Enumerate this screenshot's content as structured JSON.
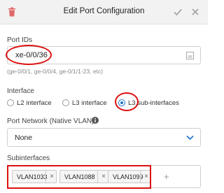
{
  "dialog": {
    "title": "Edit Port Configuration",
    "icons": {
      "delete": "trash-icon",
      "save": "check-icon",
      "close": "close-icon"
    }
  },
  "port_ids": {
    "label": "Port IDs",
    "value": "xe-0/0/36",
    "hint": "(ge-0/0/1, ge-0/0/4, ge-0/1/1-23, etc)",
    "icon": "list-icon"
  },
  "interface": {
    "label": "Interface",
    "options": [
      "L2 interface",
      "L3 interface",
      "L3 sub-interfaces"
    ],
    "selected": "L3 sub-interfaces"
  },
  "port_network": {
    "label": "Port Network (Native VLAN)",
    "value": "None",
    "icons": {
      "info": "info-icon",
      "dropdown": "chevron-down-icon"
    }
  },
  "subinterfaces": {
    "label": "Subinterfaces",
    "chips": [
      "VLAN1033",
      "VLAN1088",
      "VLAN1099"
    ],
    "remove_glyph": "×",
    "add_glyph": "+"
  },
  "colors": {
    "accent": "#1a73c8",
    "annotation": "#dd1111",
    "header_bg": "#f2f2f2"
  }
}
